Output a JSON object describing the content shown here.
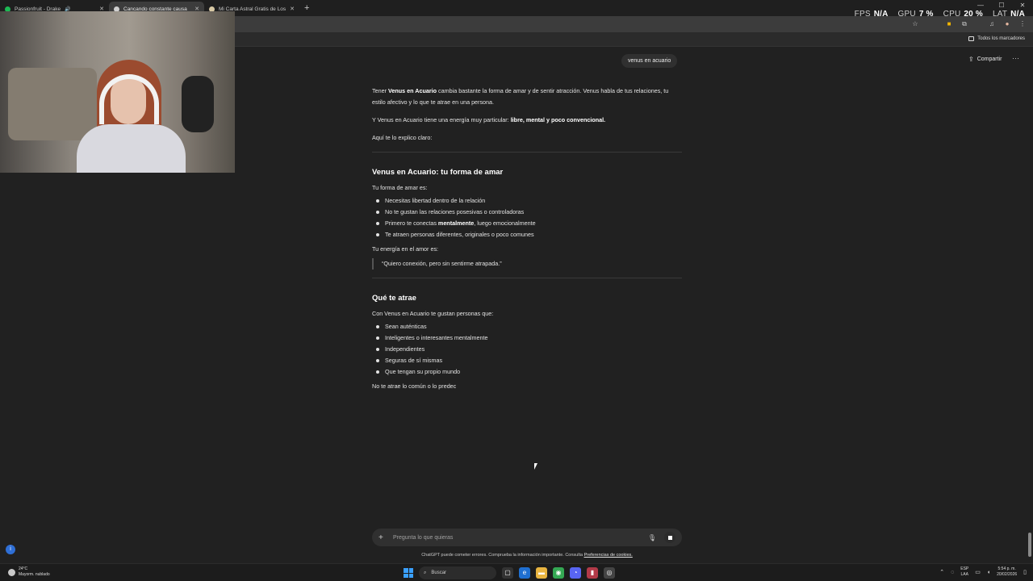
{
  "tabs": [
    {
      "title": "Passionfruit - Drake",
      "color": "#1db954",
      "speaker": "🔊"
    },
    {
      "title": "Cancando constante causa",
      "color": "#cfcfcf"
    },
    {
      "title": "Mi Carta Astral Gratis de Los A",
      "color": "#d8c9a5"
    }
  ],
  "stats": {
    "fps_label": "FPS",
    "fps_value": "N/A",
    "gpu_label": "GPU",
    "gpu_value": "7 %",
    "cpu_label": "CPU",
    "cpu_value": "20 %",
    "lat_label": "LAT",
    "lat_value": "N/A"
  },
  "bookmarks": {
    "all_label": "Todos los marcadores"
  },
  "header": {
    "share_label": "Compartir",
    "more_label": "···"
  },
  "user_message": "venus en acuario",
  "answer": {
    "intro_pre": "Tener ",
    "intro_bold": "Venus en Acuario",
    "intro_post": " cambia bastante la forma de amar y de sentir atracción. Venus habla de tus relaciones, tu estilo afectivo y lo que te atrae en una persona.",
    "energy_pre": "Y Venus en Acuario tiene una energía muy particular: ",
    "energy_bold": "libre, mental y poco convencional.",
    "explain": "Aquí te lo explico claro:",
    "section1_title": "Venus en Acuario: tu forma de amar",
    "section1_lead": "Tu forma de amar es:",
    "section1_items": {
      "a": "Necesitas libertad dentro de la relación",
      "b": "No te gustan las relaciones posesivas o controladoras",
      "c_pre": "Primero te conectas ",
      "c_bold": "mentalmente",
      "c_post": ", luego emocionalmente",
      "d": "Te atraen personas diferentes, originales o poco comunes"
    },
    "energy_lead": "Tu energía en el amor es:",
    "quote": "“Quiero conexión, pero sin sentirme atrapada.”",
    "section2_title": "Qué te atrae",
    "section2_lead": "Con Venus en Acuario te gustan personas que:",
    "section2_items": [
      "Sean auténticas",
      "Inteligentes o interesantes mentalmente",
      "Independientes",
      "Seguras de sí mismas",
      "Que tengan su propio mundo"
    ],
    "tail": "No te atrae lo común o lo predec"
  },
  "composer": {
    "placeholder": "Pregunta lo que quieras",
    "disclaimer_pre": "ChatGPT puede cometer errores. Comprueba la información importante. Consulta ",
    "disclaimer_link": "Preferencias de cookies."
  },
  "taskbar": {
    "temp": "24°C",
    "weather": "Mayorm. nublado",
    "search_label": "Buscar",
    "lang_top": "ESP",
    "lang_bottom": "LAA",
    "time": "5:54 p. m.",
    "date": "20/02/2026"
  }
}
